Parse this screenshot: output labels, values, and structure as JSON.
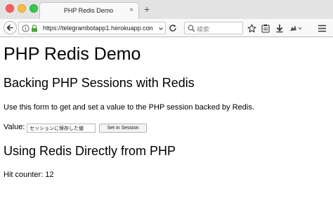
{
  "browser": {
    "tab_title": "PHP Redis Demo",
    "tab_close": "×",
    "new_tab": "+",
    "url": "https://telegrambotapp1.herokuapp.com",
    "url_trailing": "",
    "search_placeholder": "検索",
    "colors": {
      "close": "#fc605c",
      "minimize": "#fdbc40",
      "zoom": "#34c84a"
    }
  },
  "page": {
    "title": "PHP Redis Demo",
    "section1_heading": "Backing PHP Sessions with Redis",
    "section1_text": "Use this form to get and set a value to the PHP session backed by Redis.",
    "form": {
      "label": "Value:",
      "input_value": "セッションに保存した値",
      "submit_label": "Set in Session"
    },
    "section2_heading": "Using Redis Directly from PHP",
    "counter_label": "Hit counter:",
    "counter_value": "12"
  }
}
